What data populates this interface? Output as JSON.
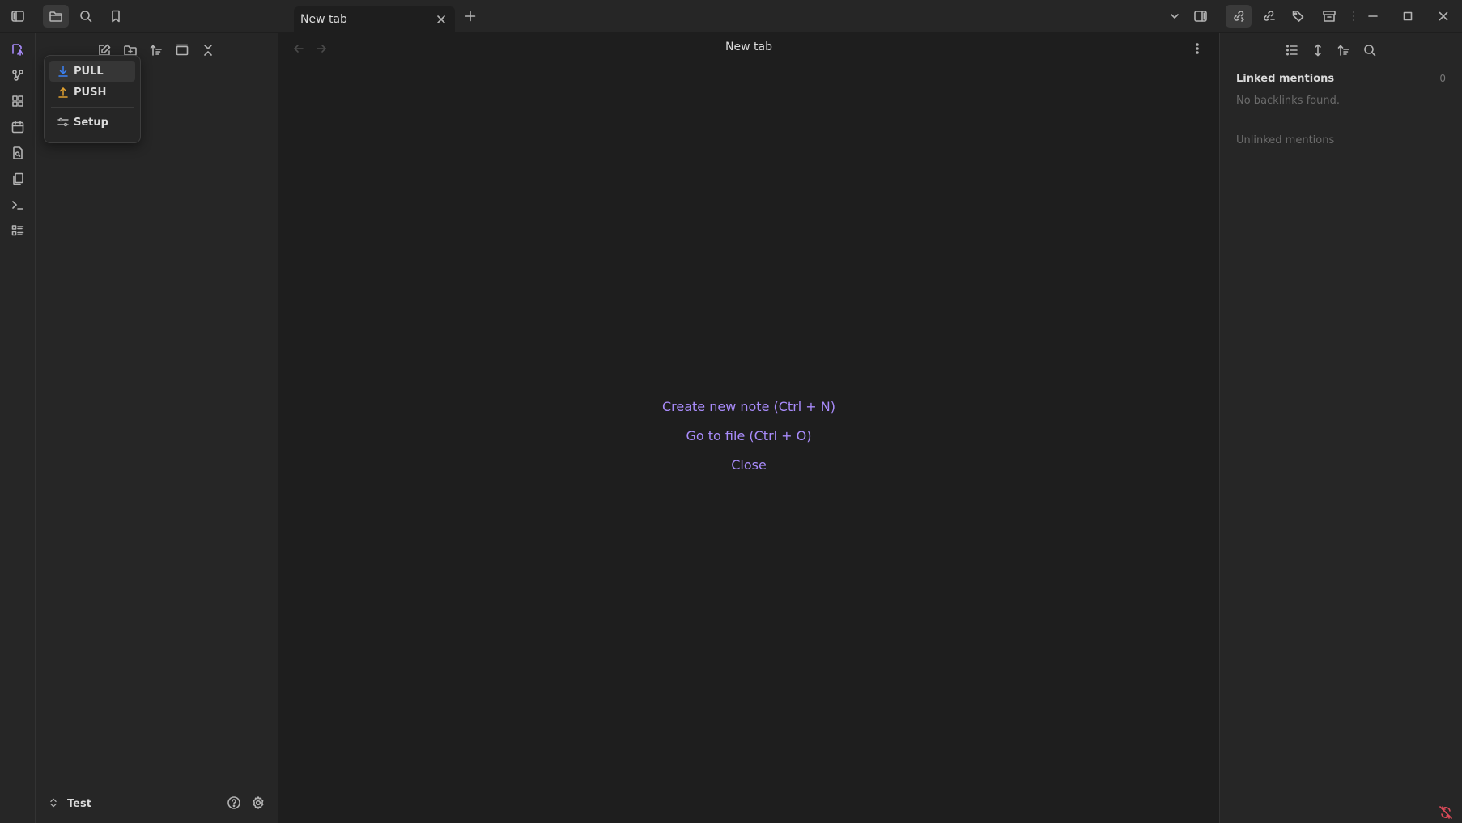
{
  "tabs": [
    {
      "label": "New tab"
    }
  ],
  "menu": {
    "items": [
      {
        "label": "PULL",
        "icon": "download-icon"
      },
      {
        "label": "PUSH",
        "icon": "upload-icon"
      },
      {
        "label": "Setup",
        "icon": "sliders-icon"
      }
    ]
  },
  "main": {
    "title": "New tab",
    "actions": [
      "Create new note (Ctrl + N)",
      "Go to file (Ctrl + O)",
      "Close"
    ]
  },
  "backlinks": {
    "linked_title": "Linked mentions",
    "linked_count": "0",
    "empty_text": "No backlinks found.",
    "unlinked_title": "Unlinked mentions"
  },
  "vault": {
    "name": "Test"
  },
  "colors": {
    "accent": "#a88bfa",
    "pull": "#3b82f6",
    "push": "#e0a030",
    "error": "#e04b5a"
  }
}
